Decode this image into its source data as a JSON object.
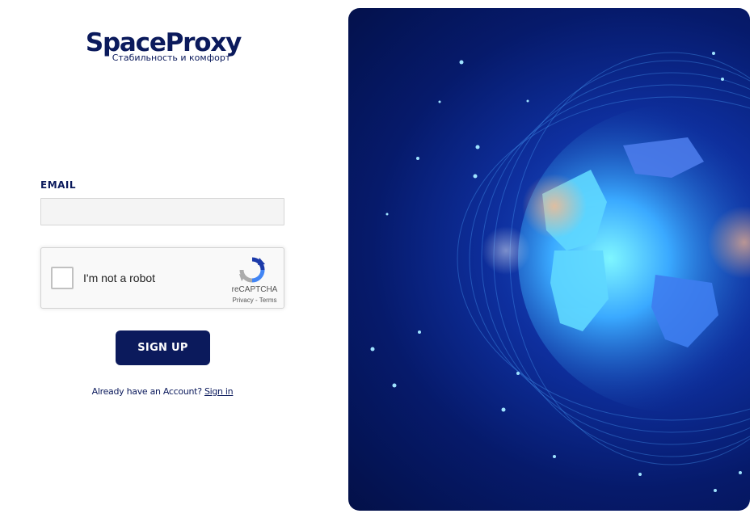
{
  "brand": {
    "title": "SpaceProxy",
    "tagline": "Стабильность и комфорт"
  },
  "form": {
    "email_label": "EMAIL",
    "email_value": "",
    "recaptcha": {
      "label": "I'm not a robot",
      "brand": "reCAPTCHA",
      "privacy": "Privacy",
      "separator": " - ",
      "terms": "Terms"
    },
    "signup_label": "SIGN UP",
    "signin_prompt": "Already have an Account? ",
    "signin_link": "Sign in"
  },
  "colors": {
    "brand_navy": "#0b1a5c",
    "hero_blue": "#0e2f9e",
    "hero_glow": "#3fd0ff"
  },
  "icons": [
    "recaptcha-logo-icon"
  ]
}
